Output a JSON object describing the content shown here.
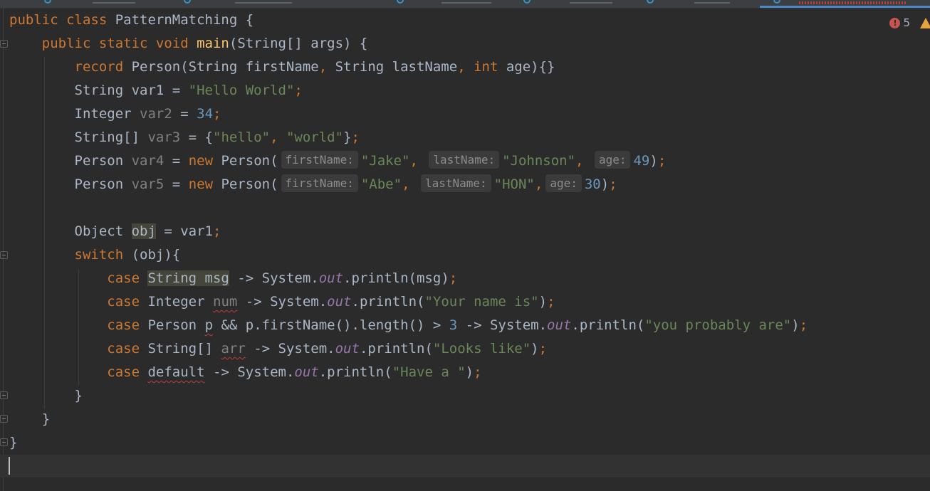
{
  "editor": {
    "inspection": {
      "error_count": "5",
      "error_icon": "error-icon",
      "warning_icon": "warning-icon"
    },
    "lines": [
      [
        [
          "kw",
          "public class "
        ],
        [
          "txt",
          "PatternMatching {"
        ]
      ],
      [
        [
          "txt",
          "    "
        ],
        [
          "kw",
          "public static void "
        ],
        [
          "fn",
          "main"
        ],
        [
          "txt",
          "(String[] args) {"
        ]
      ],
      [
        [
          "txt",
          "        "
        ],
        [
          "kw",
          "record "
        ],
        [
          "txt",
          "Person(String firstName"
        ],
        [
          "kw",
          ", "
        ],
        [
          "txt",
          "String lastName"
        ],
        [
          "kw",
          ", int "
        ],
        [
          "txt",
          "age){}"
        ]
      ],
      [
        [
          "txt",
          "        String var1 = "
        ],
        [
          "str",
          "\"Hello World\""
        ],
        [
          "kw",
          ";"
        ]
      ],
      [
        [
          "txt",
          "        Integer "
        ],
        [
          "unused",
          "var2"
        ],
        [
          "txt",
          " = "
        ],
        [
          "num",
          "34"
        ],
        [
          "kw",
          ";"
        ]
      ],
      [
        [
          "txt",
          "        String[] "
        ],
        [
          "unused",
          "var3"
        ],
        [
          "txt",
          " = {"
        ],
        [
          "str",
          "\"hello\""
        ],
        [
          "kw",
          ", "
        ],
        [
          "str",
          "\"world\""
        ],
        [
          "txt",
          "}"
        ],
        [
          "kw",
          ";"
        ]
      ],
      [
        [
          "txt",
          "        Person "
        ],
        [
          "unused",
          "var4"
        ],
        [
          "txt",
          " = "
        ],
        [
          "kw",
          "new "
        ],
        [
          "txt",
          "Person("
        ],
        [
          "hint",
          "firstName:"
        ],
        [
          "str",
          "\"Jake\""
        ],
        [
          "kw",
          ", "
        ],
        [
          "hint",
          "lastName:"
        ],
        [
          "str",
          "\"Johnson\""
        ],
        [
          "kw",
          ", "
        ],
        [
          "hint",
          "age:"
        ],
        [
          "num",
          "49"
        ],
        [
          "txt",
          ")"
        ],
        [
          "kw",
          ";"
        ]
      ],
      [
        [
          "txt",
          "        Person "
        ],
        [
          "unused",
          "var5"
        ],
        [
          "txt",
          " = "
        ],
        [
          "kw",
          "new "
        ],
        [
          "txt",
          "Person("
        ],
        [
          "hint",
          "firstName:"
        ],
        [
          "str",
          "\"Abe\""
        ],
        [
          "kw",
          ", "
        ],
        [
          "hint",
          "lastName:"
        ],
        [
          "str",
          "\"HON\""
        ],
        [
          "kw",
          ","
        ],
        [
          "hint",
          "age:"
        ],
        [
          "num",
          "30"
        ],
        [
          "txt",
          ")"
        ],
        [
          "kw",
          ";"
        ]
      ],
      [],
      [
        [
          "txt",
          "        Object "
        ],
        [
          "hl",
          "obj"
        ],
        [
          "txt",
          " = var1"
        ],
        [
          "kw",
          ";"
        ]
      ],
      [
        [
          "txt",
          "        "
        ],
        [
          "kw",
          "switch "
        ],
        [
          "txt",
          "(obj){"
        ]
      ],
      [
        [
          "txt",
          "            "
        ],
        [
          "kw",
          "case "
        ],
        [
          "hl",
          "String msg"
        ],
        [
          "txt",
          " -> System."
        ],
        [
          "field",
          "out"
        ],
        [
          "txt",
          ".println(msg)"
        ],
        [
          "kw",
          ";"
        ]
      ],
      [
        [
          "txt",
          "            "
        ],
        [
          "kw",
          "case "
        ],
        [
          "txt",
          "Integer "
        ],
        [
          "squig-unused",
          "num"
        ],
        [
          "txt",
          " -> System."
        ],
        [
          "field",
          "out"
        ],
        [
          "txt",
          ".println("
        ],
        [
          "str",
          "\"Your name is\""
        ],
        [
          "txt",
          ")"
        ],
        [
          "kw",
          ";"
        ]
      ],
      [
        [
          "txt",
          "            "
        ],
        [
          "kw",
          "case "
        ],
        [
          "txt",
          "Person "
        ],
        [
          "squig",
          "p"
        ],
        [
          "txt",
          " && p.firstName().length() > "
        ],
        [
          "num",
          "3"
        ],
        [
          "txt",
          " -> System."
        ],
        [
          "field",
          "out"
        ],
        [
          "txt",
          ".println("
        ],
        [
          "str",
          "\"you probably are\""
        ],
        [
          "txt",
          ")"
        ],
        [
          "kw",
          ";"
        ]
      ],
      [
        [
          "txt",
          "            "
        ],
        [
          "kw",
          "case "
        ],
        [
          "txt",
          "String[] "
        ],
        [
          "squig-unused",
          "arr"
        ],
        [
          "txt",
          " -> System."
        ],
        [
          "field",
          "out"
        ],
        [
          "txt",
          ".println("
        ],
        [
          "str",
          "\"Looks like\""
        ],
        [
          "txt",
          ")"
        ],
        [
          "kw",
          ";"
        ]
      ],
      [
        [
          "txt",
          "            "
        ],
        [
          "kw",
          "case "
        ],
        [
          "squig",
          "default"
        ],
        [
          "txt",
          " -> System."
        ],
        [
          "field",
          "out"
        ],
        [
          "txt",
          ".println("
        ],
        [
          "str",
          "\"Have a \""
        ],
        [
          "txt",
          ")"
        ],
        [
          "kw",
          ";"
        ]
      ],
      [
        [
          "txt",
          "        }"
        ]
      ],
      [
        [
          "txt",
          "    }"
        ]
      ],
      [
        [
          "txt",
          "}"
        ]
      ],
      []
    ]
  }
}
